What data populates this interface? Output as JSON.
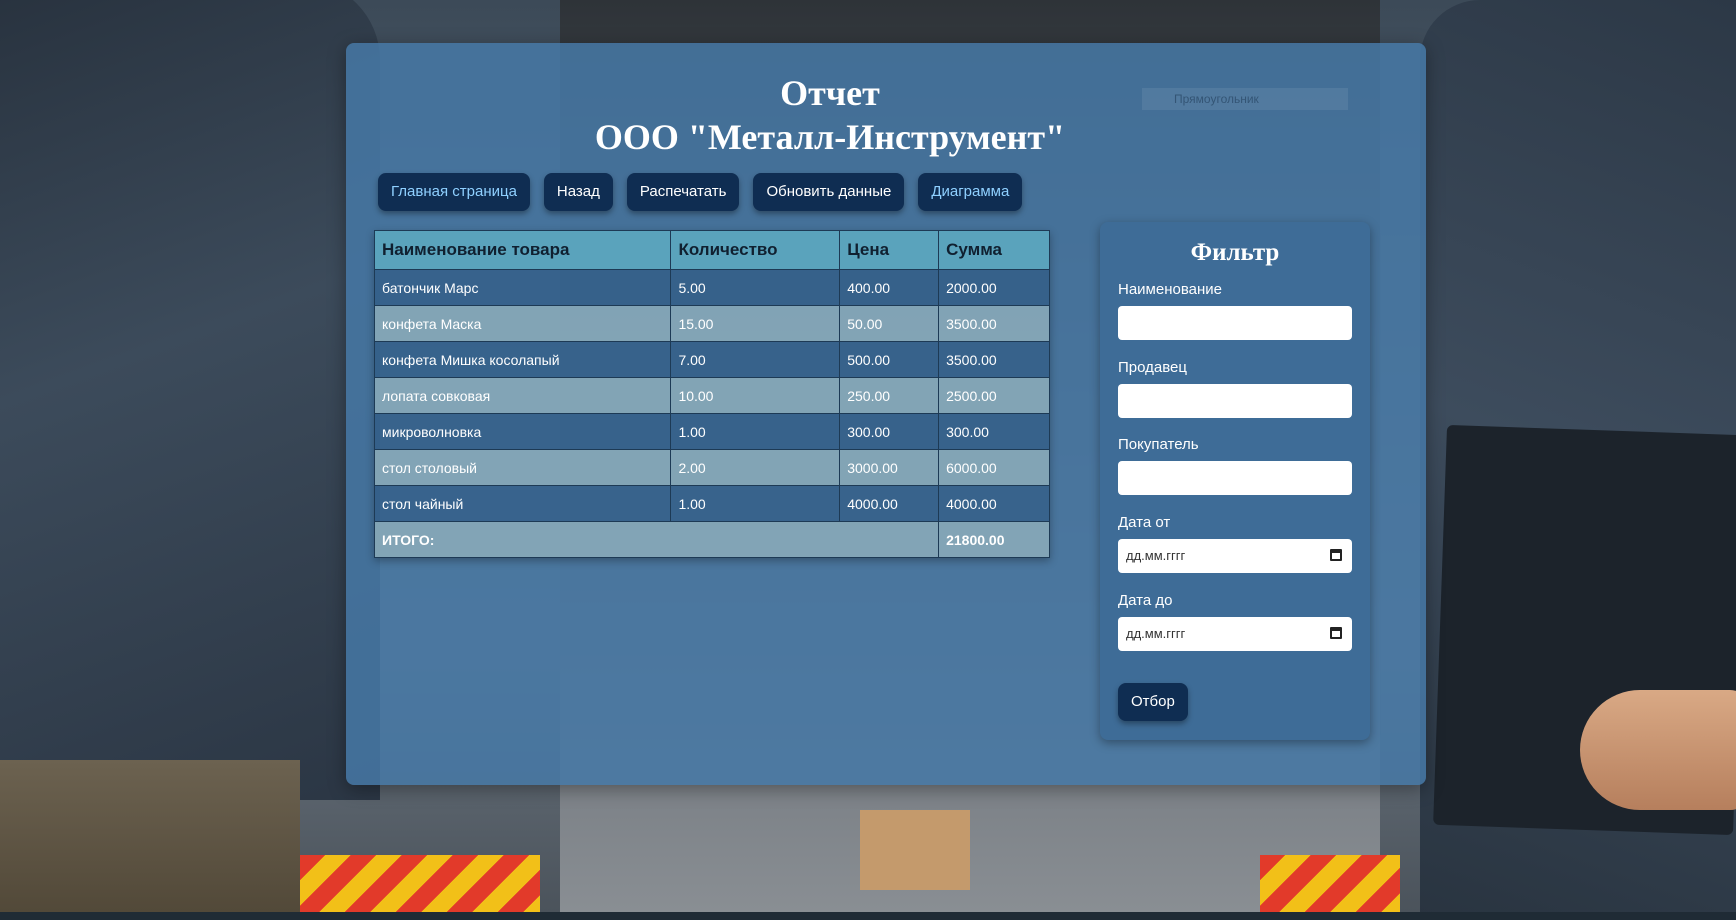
{
  "header": {
    "title_line1": "Отчет",
    "title_line2": "ООО \"Металл-Инструмент\"",
    "ghost_select": "Прямоугольник"
  },
  "nav": {
    "home": "Главная страница",
    "back": "Назад",
    "print": "Распечатать",
    "refresh": "Обновить данные",
    "chart": "Диаграмма"
  },
  "table": {
    "headers": [
      "Наименование товара",
      "Количество",
      "Цена",
      "Сумма"
    ],
    "rows": [
      [
        "батончик Марс",
        "5.00",
        "400.00",
        "2000.00"
      ],
      [
        "конфета Маска",
        "15.00",
        "50.00",
        "3500.00"
      ],
      [
        "конфета Мишка косолапый",
        "7.00",
        "500.00",
        "3500.00"
      ],
      [
        "лопата совковая",
        "10.00",
        "250.00",
        "2500.00"
      ],
      [
        "микроволновка",
        "1.00",
        "300.00",
        "300.00"
      ],
      [
        "стол столовый",
        "2.00",
        "3000.00",
        "6000.00"
      ],
      [
        "стол чайный",
        "1.00",
        "4000.00",
        "4000.00"
      ]
    ],
    "total_label": "ИТОГО:",
    "total_value": "21800.00"
  },
  "filter": {
    "title": "Фильтр",
    "name_label": "Наименование",
    "seller_label": "Продавец",
    "buyer_label": "Покупатель",
    "date_from_label": "Дата от",
    "date_to_label": "Дата до",
    "date_placeholder": "дд.мм.гггг",
    "apply": "Отбор"
  }
}
